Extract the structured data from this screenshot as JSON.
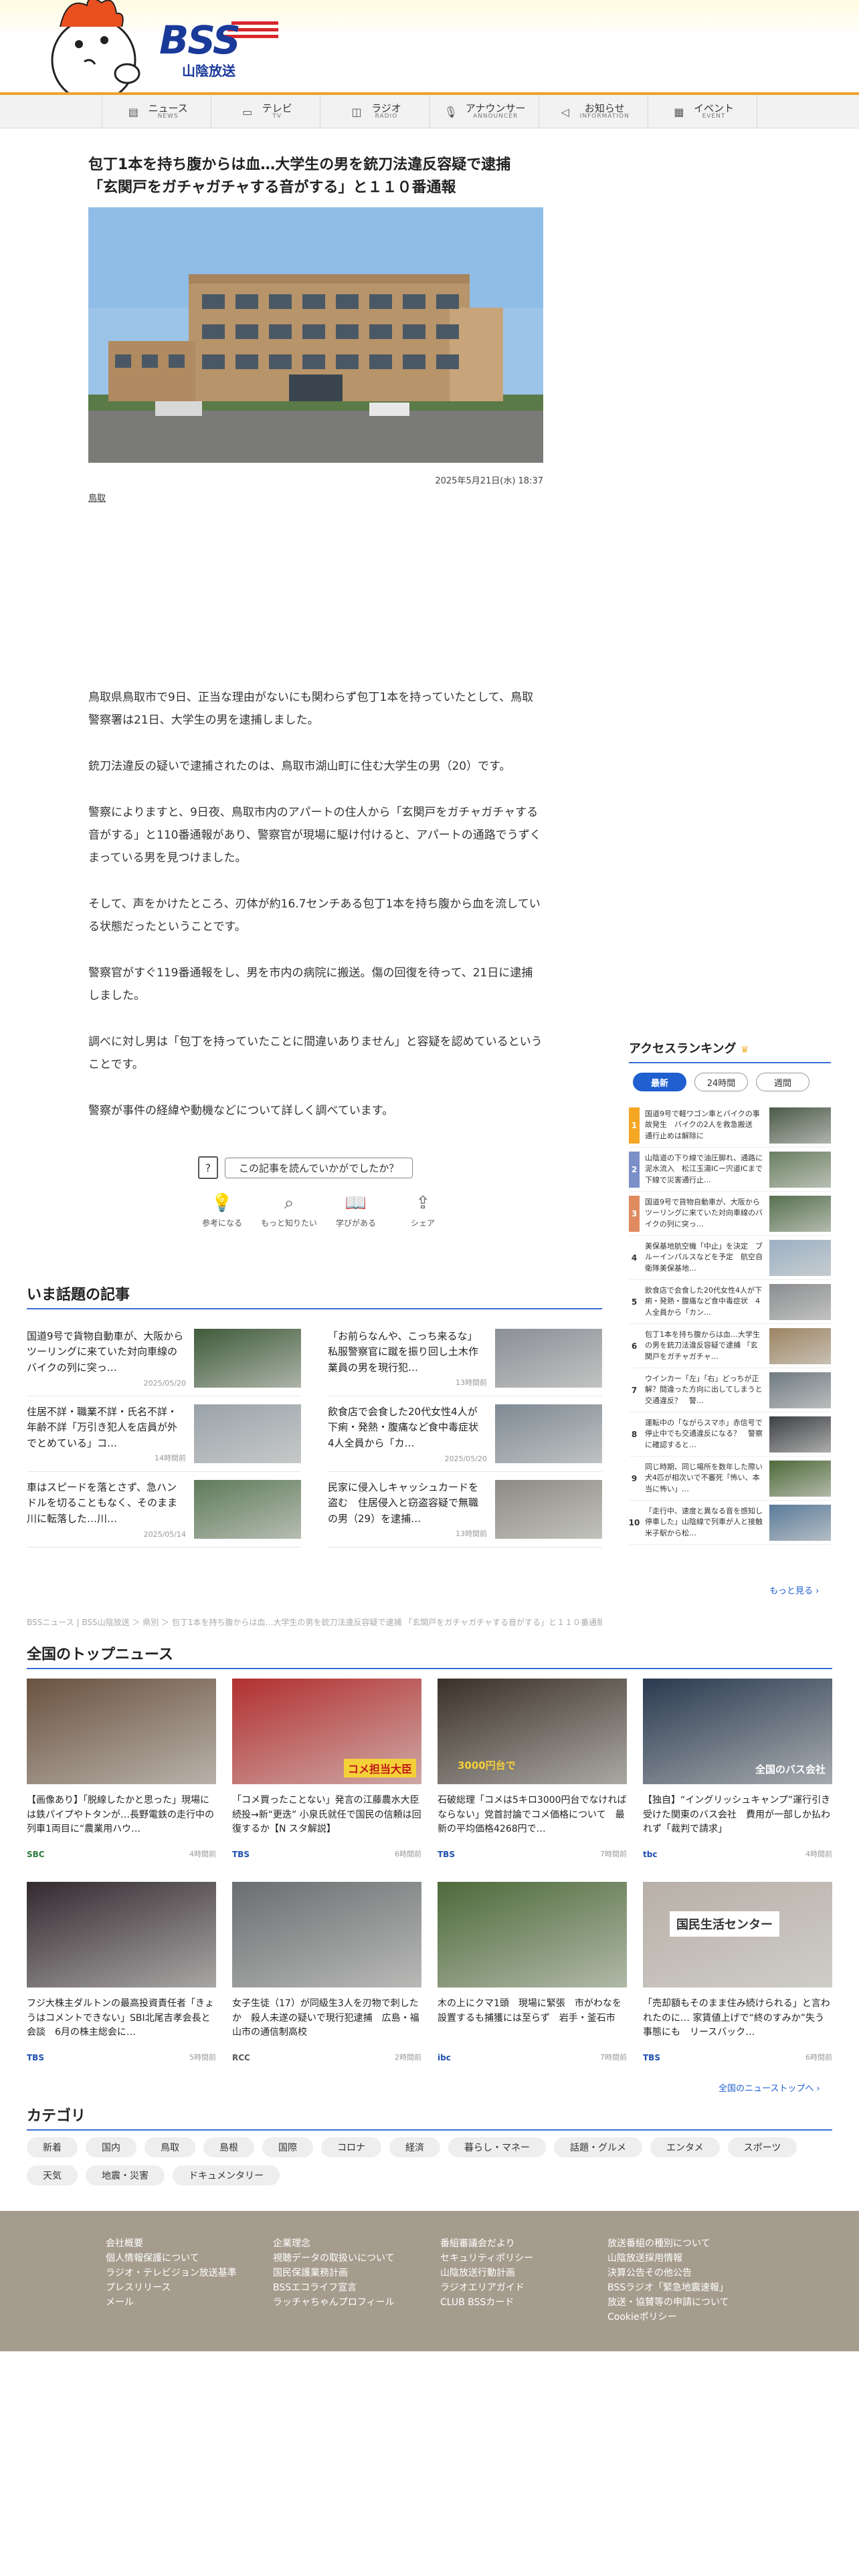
{
  "brand": {
    "logo": "BSS",
    "sub": "山陰放送"
  },
  "nav": [
    {
      "label": "ニュース",
      "sub": "NEWS",
      "icon": "newspaper-icon"
    },
    {
      "label": "テレビ",
      "sub": "TV",
      "icon": "tv-icon"
    },
    {
      "label": "ラジオ",
      "sub": "RADIO",
      "icon": "radio-icon"
    },
    {
      "label": "アナウンサー",
      "sub": "ANNOUNCER",
      "icon": "microphone-icon"
    },
    {
      "label": "お知らせ",
      "sub": "INFORMATION",
      "icon": "megaphone-icon"
    },
    {
      "label": "イベント",
      "sub": "EVENT",
      "icon": "calendar-icon"
    }
  ],
  "article": {
    "title": "包丁1本を持ち腹からは血…大学生の男を銃刀法違反容疑で逮捕 「玄関戸をガチャガチャする音がする」と１１０番通報",
    "date": "2025年5月21日(水) 18:37",
    "tag": "鳥取",
    "paragraphs": [
      "鳥取県鳥取市で9日、正当な理由がないにも関わらず包丁1本を持っていたとして、鳥取警察署は21日、大学生の男を逮捕しました。",
      "銃刀法違反の疑いで逮捕されたのは、鳥取市湖山町に住む大学生の男（20）です。",
      "警察によりますと、9日夜、鳥取市内のアパートの住人から「玄関戸をガチャガチャする音がする」と110番通報があり、警察官が現場に駆け付けると、アパートの通路でうずくまっている男を見つけました。",
      "そして、声をかけたところ、刃体が約16.7センチある包丁1本を持ち腹から血を流している状態だったということです。",
      "警察官がすぐ119番通報をし、男を市内の病院に搬送。傷の回復を待って、21日に逮捕しました。",
      "調べに対し男は「包丁を持っていたことに間違いありません」と容疑を認めているということです。",
      "警察が事件の経緯や動機などについて詳しく調べています。"
    ],
    "feedback_label": "この記事を読んでいかがでしたか？",
    "reactions": [
      {
        "label": "参考になる",
        "icon": "lightbulb-icon"
      },
      {
        "label": "もっと知りたい",
        "icon": "magnifier-icon"
      },
      {
        "label": "学びがある",
        "icon": "book-icon"
      },
      {
        "label": "シェア",
        "icon": "share-icon"
      }
    ]
  },
  "trending": {
    "heading": "いま話題の記事",
    "items": [
      {
        "title": "国道9号で貨物自動車が、大阪からツーリングに来ていた対向車線のバイクの列に突っ…",
        "date": "2025/05/20",
        "color": "#3f5a3a"
      },
      {
        "title": "「お前らなんや、こっち来るな」私服警察官に蹴を振り回し土木作業員の男を現行犯…",
        "date": "13時間前",
        "color": "#8a8f96"
      },
      {
        "title": "住居不詳・職業不詳・氏名不詳・年齢不詳「万引き犯人を店員が外でとめている」コ…",
        "date": "14時間前",
        "color": "#9aa3aa"
      },
      {
        "title": "飲食店で会食した20代女性4人が下痢・発熱・腹痛など食中毒症状　4人全員から「カ…",
        "date": "2025/05/20",
        "color": "#7f8a94"
      },
      {
        "title": "車はスピードを落とさず、急ハンドルを切ることもなく、そのまま川に転落した…川…",
        "date": "2025/05/14",
        "color": "#5f7a5a"
      },
      {
        "title": "民家に侵入しキャッシュカードを盗む　住居侵入と窃盗容疑で無職の男（29）を逮捕…",
        "date": "13時間前",
        "color": "#8c8a84"
      }
    ]
  },
  "breadcrumb": "BSSニュース | BSS山陰放送 ＞ 県別 ＞ 包丁1本を持ち腹からは血…大学生の男を銃刀法違反容疑で逮捕 「玄関戸をガチャガチャする音がする」と１１０番通報",
  "ranking": {
    "heading": "アクセスランキング",
    "tabs": [
      "最新",
      "24時間",
      "週間"
    ],
    "items": [
      {
        "rank": "1",
        "title": "国道9号で軽ワゴン車とバイクの事故発生　バイクの2人を救急搬送　通行止めは解除に",
        "color": "#4a5a48"
      },
      {
        "rank": "2",
        "title": "山陰道の下り線で油圧脚れ、通路に泥水流入　松江玉湯ICー宍道ICまで下線で災害通行止…",
        "color": "#6a7f62"
      },
      {
        "rank": "3",
        "title": "国道9号で貨物自動車が、大阪からツーリングに来ていた対向車線のバイクの列に突っ…",
        "color": "#57704f"
      },
      {
        "rank": "4",
        "title": "美保基地航空機「中止」を決定　ブルーインパルスなどを予定　航空自衛隊美保基地…",
        "color": "#9bb0c4"
      },
      {
        "rank": "5",
        "title": "飲食店で会食した20代女性4人が下痢・発熱・腹痛など食中毒症状　4人全員から「カン…",
        "color": "#8a8d90"
      },
      {
        "rank": "6",
        "title": "包丁1本を持ち腹からは血…大学生の男を銃刀法違反容疑で逮捕 「玄関戸をガチャガチャ…",
        "color": "#9d8462"
      },
      {
        "rank": "7",
        "title": "ウインカー「左」「右」どっちが正解？間違った方向に出してしまうと交通違反？　警…",
        "color": "#6f7a82"
      },
      {
        "rank": "8",
        "title": "運転中の「ながらスマホ」赤信号で停止中でも交通違反になる？　警察に確認すると…",
        "color": "#3d3f44"
      },
      {
        "rank": "9",
        "title": "同じ時期、同じ場所を数年した際い犬4匹が相次いで不審死「怖い、本当に怖い」…",
        "color": "#4f6a3a"
      },
      {
        "rank": "10",
        "title": "「走行中、速度と異なる音を感知し停車した」山陰線で列車が人と接触　米子駅から松…",
        "color": "#5a7a9a"
      }
    ],
    "more": "もっと見る"
  },
  "national": {
    "heading": "全国のトップニュース",
    "items": [
      {
        "title": "【画像あり】「脱線したかと思った」現場には鉄パイプやトタンが…長野電鉄の走行中の列車1両目に“農業用ハウ…",
        "source": "SBC",
        "date": "4時間前",
        "color": "#6a5240",
        "caption": ""
      },
      {
        "title": "「コメ買ったことない」発言の江藤農水大臣 続投→新“更迭” 小泉氏就任で国民の信頼は回復するか【N スタ解説】",
        "source": "TBS",
        "date": "6時間前",
        "color": "#b23030",
        "caption": "コメ担当大臣"
      },
      {
        "title": "石破総理「コメは5キロ3000円台でなければならない」党首討論でコメ価格について　最新の平均価格4268円で…",
        "source": "TBS",
        "date": "7時間前",
        "color": "#3a3028",
        "caption": "3000円台で"
      },
      {
        "title": "【独自】“イングリッシュキャンプ”運行引き受けた関東のバス会社　費用が一部しか払われず「裁判で請求」",
        "source": "tbc",
        "date": "4時間前",
        "color": "#2a3a50",
        "caption": "全国のバス会社"
      },
      {
        "title": "フジ大株主ダルトンの最高投資責任者「きょうはコメントできない」SBI北尾吉孝会長と会談　6月の株主総会に…",
        "source": "TBS",
        "date": "5時間前",
        "color": "#332a30",
        "caption": ""
      },
      {
        "title": "女子生徒（17）が同級生3人を刃物で刺したか　殺人未遂の疑いで現行犯逮捕　広島・福山市の通信制高校",
        "source": "RCC",
        "date": "2時間前",
        "color": "#6a6e70",
        "caption": ""
      },
      {
        "title": "木の上にクマ1頭　現場に緊張　市がわなを設置するも捕獲には至らず　岩手・釜石市",
        "source": "ibc",
        "date": "7時間前",
        "color": "#4e6a3a",
        "caption": ""
      },
      {
        "title": "「売却額もそのまま住み続けられる」と言われたのに… 家賃値上げで“終のすみか”失う事態にも　リースバック…",
        "source": "TBS",
        "date": "6時間前",
        "color": "#b8b0a8",
        "caption": "国民生活センター"
      }
    ],
    "more": "全国のニューストップへ"
  },
  "categories": {
    "heading": "カテゴリ",
    "items": [
      "新着",
      "国内",
      "鳥取",
      "島根",
      "国際",
      "コロナ",
      "経済",
      "暮らし・マネー",
      "話題・グルメ",
      "エンタメ",
      "スポーツ",
      "天気",
      "地震・災害",
      "ドキュメンタリー"
    ]
  },
  "footer": {
    "columns": [
      [
        "会社概要",
        "個人情報保護について",
        "ラジオ・テレビジョン放送基準",
        "プレスリリース",
        "メール"
      ],
      [
        "企業理念",
        "視聴データの取扱いについて",
        "国民保護業務計画",
        "BSSエコライフ宣言",
        "ラッチャちゃんプロフィール"
      ],
      [
        "番組審議会だより",
        "セキュリティポリシー",
        "山陰放送行動計画",
        "ラジオエリアガイド",
        "CLUB BSSカード"
      ],
      [
        "放送番組の種別について",
        "山陰放送採用情報",
        "決算公告その他公告",
        "BSSラジオ「緊急地震速報」",
        "放送・協賛等の申請について",
        "Cookieポリシー"
      ]
    ]
  }
}
